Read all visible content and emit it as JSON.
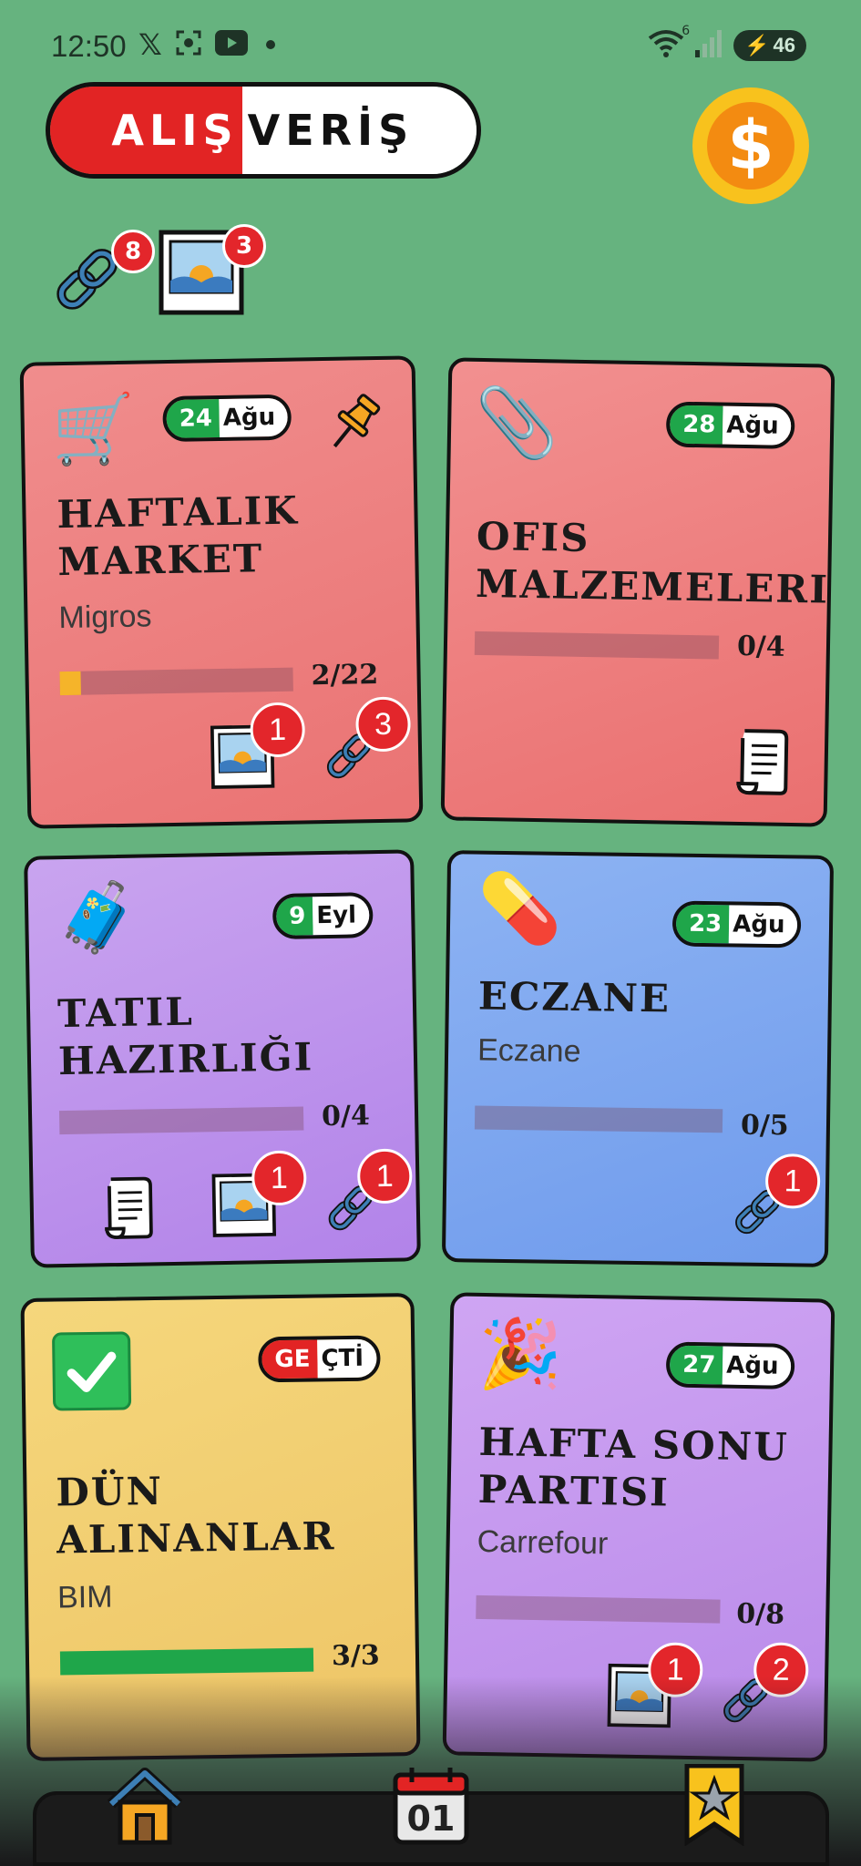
{
  "status": {
    "time": "12:50",
    "battery": "46",
    "wifi_label": "6"
  },
  "header": {
    "title_left": "ALIŞ",
    "title_right": "VERİŞ",
    "coin_symbol": "$"
  },
  "top_counts": {
    "links": "8",
    "images": "3"
  },
  "cards": [
    {
      "emoji": "🛒",
      "date_day": "24",
      "date_month": "Ağu",
      "title_line1": "Haftalık",
      "title_line2": "Market",
      "subtitle": "Migros",
      "progress_text": "2/22",
      "progress_fraction": 0.09,
      "image_badge": "1",
      "link_badge": "3",
      "color": "#ee7b7b"
    },
    {
      "emoji": "📎",
      "date_day": "28",
      "date_month": "Ağu",
      "title_line1": "Ofis",
      "title_line2": "Malzemeleri",
      "subtitle": "",
      "progress_text": "0/4",
      "progress_fraction": 0,
      "color": "#ee7b7b"
    },
    {
      "emoji": "🧳",
      "date_day": "9",
      "date_month": "Eyl",
      "title_line1": "Tatil",
      "title_line2": "Hazırlığı",
      "subtitle": "",
      "progress_text": "0/4",
      "progress_fraction": 0,
      "image_badge": "1",
      "link_badge": "1",
      "color": "#b98de8"
    },
    {
      "emoji": "💊",
      "date_day": "23",
      "date_month": "Ağu",
      "title_line1": "Eczane",
      "title_line2": "",
      "subtitle": "Eczane",
      "progress_text": "0/5",
      "progress_fraction": 0,
      "link_badge": "1",
      "color": "#80a9f0"
    },
    {
      "emoji": "✅",
      "date_day": "GE",
      "date_month": "ÇTİ",
      "title_line1": "Dün",
      "title_line2": "Alınanlar",
      "subtitle": "BIM",
      "progress_text": "3/3",
      "progress_fraction": 1,
      "color": "#f2d06e"
    },
    {
      "emoji": "🎉",
      "date_day": "27",
      "date_month": "Ağu",
      "title_line1": "Hafta Sonu",
      "title_line2": "Partisi",
      "subtitle": "Carrefour",
      "progress_text": "0/8",
      "progress_fraction": 0,
      "image_badge": "1",
      "link_badge": "2",
      "color": "#c497f0"
    }
  ],
  "nav": {
    "calendar_day": "01"
  },
  "colors": {
    "background": "#66b37f",
    "accent_red": "#e22424",
    "date_green": "#1fa64a",
    "progress_yellow": "#f5b42a",
    "progress_green": "#1fa64a"
  }
}
